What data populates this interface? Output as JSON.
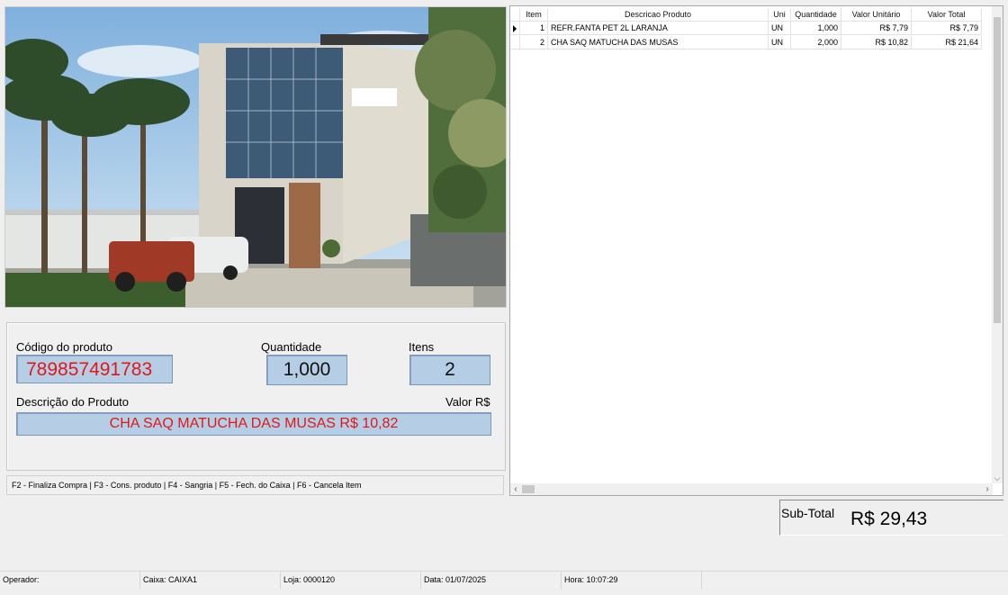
{
  "input": {
    "code_label": "Código do produto",
    "code_value": "789857491783",
    "qty_label": "Quantidade",
    "qty_value": "1,000",
    "items_label": "Itens",
    "items_value": "2",
    "desc_label": "Descrição do Produto",
    "price_label": "Valor R$",
    "desc_value": "CHA SAQ MATUCHA DAS MUSAS  R$ 10,82"
  },
  "shortcuts": "F2 - Finaliza Compra  | F3 - Cons. produto | F4 - Sangria  | F5 - Fech. do Caixa  | F6 - Cancela Item",
  "grid": {
    "headers": [
      "Item",
      "Descricao Produto",
      "Uni",
      "Quantidade",
      "Valor Unitário",
      "Valor Total"
    ],
    "rows": [
      {
        "item": "1",
        "desc": "REFR.FANTA PET 2L LARANJA",
        "uni": "UN",
        "qty": "1,000",
        "unit": "R$ 7,79",
        "total": "R$ 7,79"
      },
      {
        "item": "2",
        "desc": "CHA SAQ MATUCHA DAS MUSAS",
        "uni": "UN",
        "qty": "2,000",
        "unit": "R$ 10,82",
        "total": "R$ 21,64"
      }
    ]
  },
  "subtotal": {
    "label": "Sub-Total",
    "value": "R$ 29,43"
  },
  "status": {
    "operator": "Operador:",
    "register": "Caixa: CAIXA1",
    "store": "Loja: 0000120",
    "date": "Data: 01/07/2025",
    "time": "Hora: 10:07:29"
  },
  "colors": {
    "field_bg": "#b6cde6",
    "highlight_text": "#e01818"
  }
}
